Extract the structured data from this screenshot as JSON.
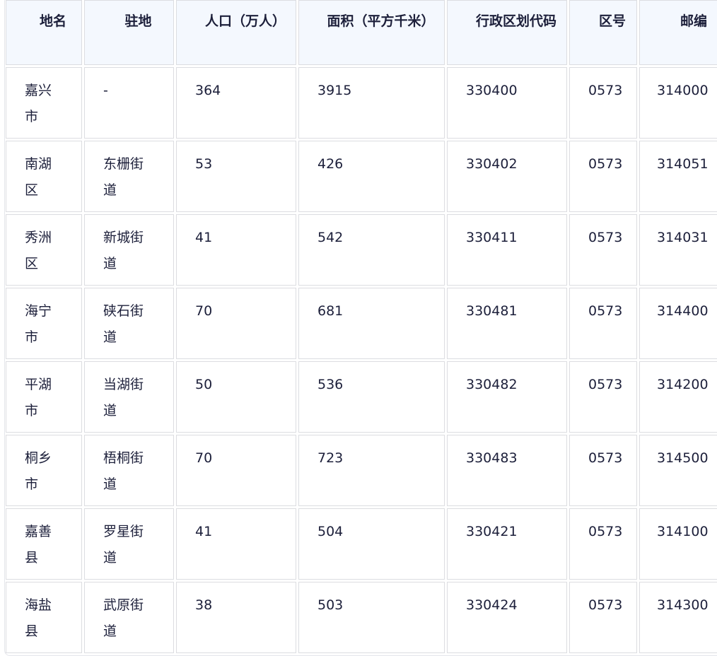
{
  "table": {
    "headers": [
      "地名",
      "驻地",
      "人口（万人）",
      "面积（平方千米）",
      "行政区划代码",
      "区号",
      "邮编"
    ],
    "rows": [
      [
        "嘉兴市",
        "-",
        "364",
        "3915",
        "330400",
        "0573",
        "314000"
      ],
      [
        "南湖区",
        "东栅街道",
        "53",
        "426",
        "330402",
        "0573",
        "314051"
      ],
      [
        "秀洲区",
        "新城街道",
        "41",
        "542",
        "330411",
        "0573",
        "314031"
      ],
      [
        "海宁市",
        "硖石街道",
        "70",
        "681",
        "330481",
        "0573",
        "314400"
      ],
      [
        "平湖市",
        "当湖街道",
        "50",
        "536",
        "330482",
        "0573",
        "314200"
      ],
      [
        "桐乡市",
        "梧桐街道",
        "70",
        "723",
        "330483",
        "0573",
        "314500"
      ],
      [
        "嘉善县",
        "罗星街道",
        "41",
        "504",
        "330421",
        "0573",
        "314100"
      ],
      [
        "海盐县",
        "武原街道",
        "38",
        "503",
        "330424",
        "0573",
        "314300"
      ]
    ]
  }
}
